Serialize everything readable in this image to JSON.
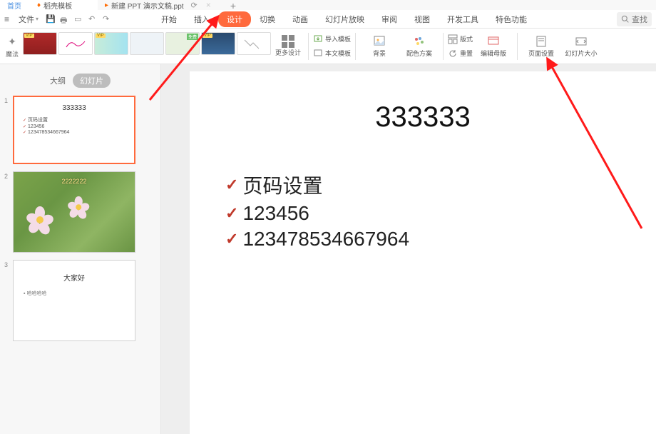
{
  "tabs": {
    "home": "首页",
    "docer": "稻壳模板",
    "doc": "新建 PPT 演示文稿.ppt"
  },
  "menu": {
    "file": "文件",
    "items": [
      "开始",
      "插入",
      "设计",
      "切换",
      "动画",
      "幻灯片放映",
      "审阅",
      "视图",
      "开发工具",
      "特色功能"
    ],
    "activeIndex": 2,
    "search": "查找"
  },
  "ribbon": {
    "magic": "魔法",
    "more_design": "更多设计",
    "import_template": "导入模板",
    "local_template": "本文模板",
    "background": "背景",
    "color_scheme": "配色方案",
    "layout": "版式",
    "reset": "重置",
    "edit_master": "编辑母版",
    "page_setup": "页面设置",
    "slide_size": "幻灯片大小"
  },
  "sidepanel": {
    "outline": "大纲",
    "slides": "幻灯片"
  },
  "thumbnails": [
    {
      "title": "333333",
      "lines": [
        "页码设置",
        "123456",
        "123478534667964"
      ]
    },
    {
      "overlay": "2222222"
    },
    {
      "title": "大家好",
      "line": "哈哈哈哈"
    }
  ],
  "slide": {
    "title": "333333",
    "items": [
      "页码设置",
      "123456",
      "123478534667964"
    ]
  }
}
